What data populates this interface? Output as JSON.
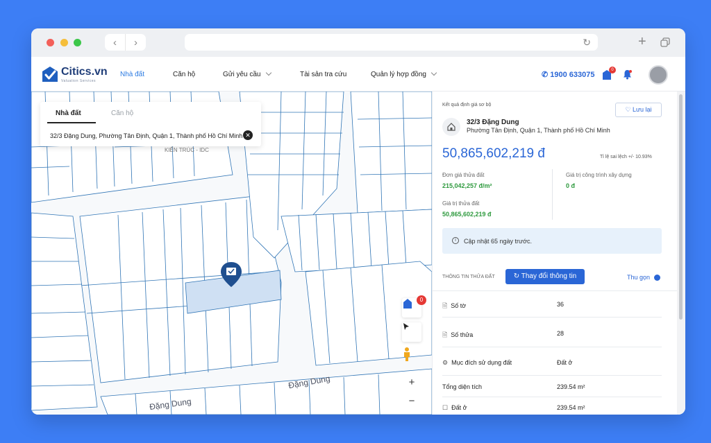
{
  "header": {
    "logo": "Citics.vn",
    "logo_sub": "Valuation Services",
    "nav": [
      {
        "label": "Nhà đất"
      },
      {
        "label": "Căn hộ"
      },
      {
        "label": "Gửi yêu cầu"
      },
      {
        "label": "Tài sản tra cứu"
      },
      {
        "label": "Quản lý hợp đồng"
      }
    ],
    "phone": "1900 633075",
    "cart_badge": "0"
  },
  "search": {
    "tabs": [
      "Nhà đất",
      "Căn hộ"
    ],
    "address": "32/3 Đặng Dung, Phường Tân Định, Quận 1, Thành phố Hồ Chí Minh"
  },
  "map": {
    "street1": "Đặng Dung",
    "street2": "Đặng Dung",
    "poi": "KIẾN TRÚC - IDC",
    "layer_badge": "0",
    "zoom_in": "+",
    "zoom_out": "−"
  },
  "panel": {
    "result_label": "Kết quả định giá sơ bộ",
    "save_label": "Lưu lại",
    "address_title": "32/3 Đặng Dung",
    "address_sub": "Phường Tân Định, Quận 1, Thành phố Hồ Chí Minh",
    "total_price": "50,865,602,219 đ",
    "error_rate": "Tỉ lệ sai lệch +/- 10.93%",
    "unit_price_label": "Đơn giá thửa đất",
    "unit_price": "215,042,257 đ/m²",
    "building_label": "Giá trị công trình xây dựng",
    "building_value": "0 đ",
    "land_value_label": "Giá trị thửa đất",
    "land_value": "50,865,602,219 đ",
    "update_note": "Cập nhật 65 ngày trước.",
    "section_title": "THÔNG TIN THỬA ĐẤT",
    "change_button": "Thay đổi thông tin",
    "collapse_label": "Thu gọn",
    "rows": [
      {
        "label": "Số tờ",
        "value": "36",
        "icon": "doc-icon"
      },
      {
        "label": "Số thửa",
        "value": "28",
        "icon": "doc-icon"
      },
      {
        "label": "Mục đích sử dụng đất",
        "value": "Đất ở",
        "icon": "gear-icon"
      },
      {
        "label": "Tổng diện tích",
        "value": "239.54 m²",
        "icon": ""
      },
      {
        "label": "Đất ở",
        "value": "239.54 m²",
        "icon": "checkbox-icon"
      }
    ]
  }
}
